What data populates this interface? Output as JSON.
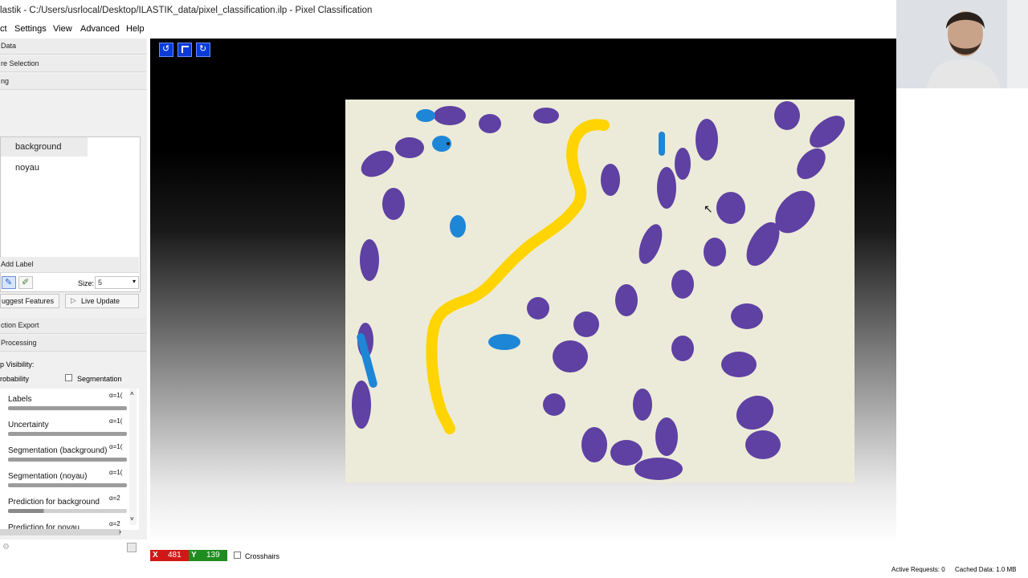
{
  "window": {
    "title": "lastik - C:/Users/usrlocal/Desktop/ILASTIK_data/pixel_classification.ilp - Pixel Classification"
  },
  "menu": [
    "ct",
    "Settings",
    "View",
    "Advanced",
    "Help"
  ],
  "applets": [
    "Data",
    "re Selection",
    "ng"
  ],
  "labels": [
    {
      "name": "background"
    },
    {
      "name": "noyau"
    }
  ],
  "add_label": "Add Label",
  "size": {
    "label": "Size:",
    "value": "5"
  },
  "buttons": {
    "suggest": "uggest Features",
    "live": "Live Update"
  },
  "applets_lower": [
    "ction Export",
    "Processing"
  ],
  "visibility": {
    "title": "p Visibility:",
    "probability": "robability",
    "segmentation": "Segmentation"
  },
  "layers": [
    {
      "name": "Labels",
      "alpha": "α=1("
    },
    {
      "name": "Uncertainty",
      "alpha": "α=1("
    },
    {
      "name": "Segmentation (background)",
      "alpha": "α=1("
    },
    {
      "name": "Segmentation (noyau)",
      "alpha": "α=1("
    },
    {
      "name": "Prediction for background",
      "alpha": "α=2"
    },
    {
      "name": "Prediction for noyau",
      "alpha": "α=2"
    }
  ],
  "coords": {
    "x_label": "X",
    "x": "481",
    "y_label": "Y",
    "y": "139",
    "crosshairs": "Crosshairs"
  },
  "status": {
    "requests": "Active Requests: 0",
    "cache": "Cached Data: 1.0 MB"
  },
  "colors": {
    "accent": "#0a3bd9",
    "x_badge": "#d01818",
    "y_badge": "#1f8c1f",
    "label_yellow": "#ffd400",
    "label_blue": "#1e86d6"
  }
}
